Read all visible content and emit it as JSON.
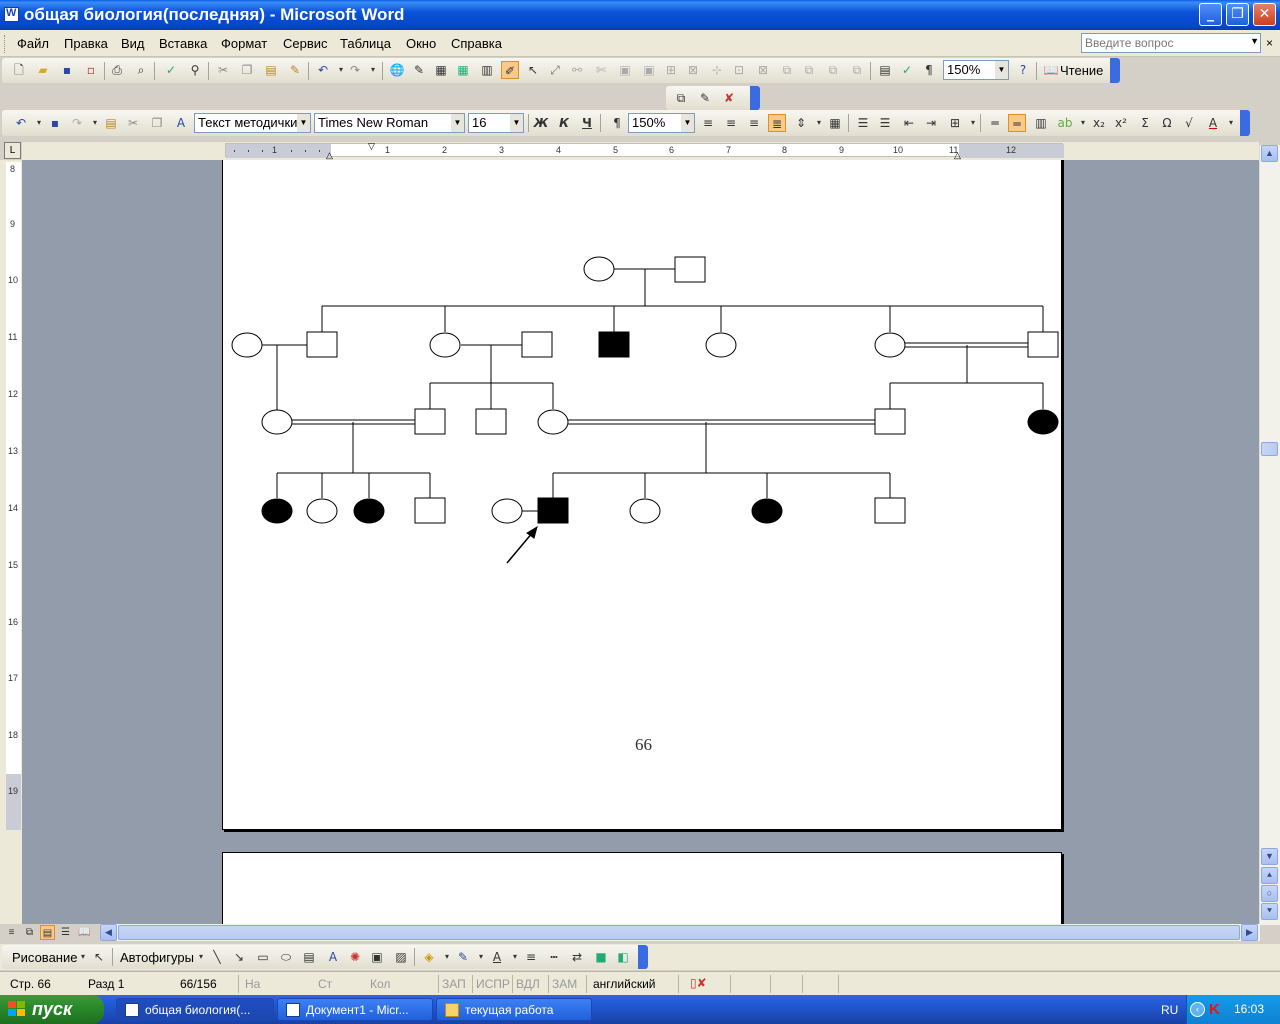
{
  "window": {
    "title": "общая биология(последняя) - Microsoft Word",
    "controls": {
      "minimize": "_",
      "maximize": "❐",
      "close": "✕"
    }
  },
  "menu": {
    "items": [
      "Файл",
      "Правка",
      "Вид",
      "Вставка",
      "Формат",
      "Сервис",
      "Таблица",
      "Окно",
      "Справка"
    ],
    "ask_placeholder": "Введите вопрос"
  },
  "standard_toolbar": {
    "zoom": "150%",
    "reading_label": "Чтение"
  },
  "formatting_toolbar": {
    "style": "Текст методички",
    "font": "Times New Roman",
    "size": "16",
    "zoom": "150%",
    "bold": "Ж",
    "italic": "К",
    "underline": "Ч",
    "pilcrow": "¶"
  },
  "ruler": {
    "h_numbers": [
      "1",
      "1",
      "2",
      "3",
      "4",
      "5",
      "6",
      "7",
      "8",
      "9",
      "10",
      "11",
      "12"
    ],
    "v_numbers": [
      "8",
      "9",
      "10",
      "11",
      "12",
      "13",
      "14",
      "15",
      "16",
      "17",
      "18",
      "19"
    ],
    "corner": "L"
  },
  "page": {
    "number": "66"
  },
  "draw_toolbar": {
    "draw_label": "Рисование",
    "autoshapes_label": "Автофигуры"
  },
  "status": {
    "page": "Стр. 66",
    "section": "Разд 1",
    "pages": "66/156",
    "at": "На",
    "line": "Ст",
    "col": "Кол",
    "rec": "ЗАП",
    "trk": "ИСПР",
    "ext": "ВДЛ",
    "ovr": "ЗАМ",
    "language": "английский"
  },
  "taskbar": {
    "start": "пуск",
    "items": [
      "общая биология(...",
      "Документ1 - Micr...",
      "текущая работа"
    ],
    "lang": "RU",
    "clock": "16:03"
  }
}
